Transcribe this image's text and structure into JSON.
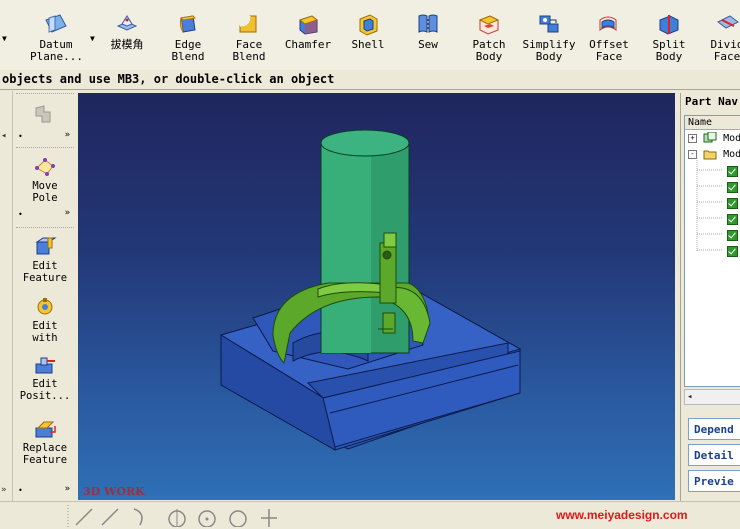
{
  "toolbar": {
    "items": [
      {
        "label": "Datum\nPlane...",
        "icon": "datum-plane-icon"
      },
      {
        "label": "拔模角",
        "icon": "draft-icon"
      },
      {
        "label": "Edge\nBlend",
        "icon": "edge-blend-icon"
      },
      {
        "label": "Face\nBlend",
        "icon": "face-blend-icon"
      },
      {
        "label": "Chamfer",
        "icon": "chamfer-icon"
      },
      {
        "label": "Shell",
        "icon": "shell-icon"
      },
      {
        "label": "Sew",
        "icon": "sew-icon"
      },
      {
        "label": "Patch\nBody",
        "icon": "patch-body-icon"
      },
      {
        "label": "Simplify\nBody",
        "icon": "simplify-body-icon"
      },
      {
        "label": "Offset\nFace",
        "icon": "offset-face-icon"
      },
      {
        "label": "Split\nBody",
        "icon": "split-body-icon"
      },
      {
        "label": "Divid\nFace",
        "icon": "divide-face-icon"
      }
    ]
  },
  "status": {
    "text": "objects and use MB3, or double-click an object"
  },
  "palette": {
    "items": [
      {
        "label": "Move\nPole",
        "icon": "move-pole-icon"
      },
      {
        "label": "Edit\nFeature",
        "icon": "edit-feature-icon"
      },
      {
        "label": "Edit\nwith",
        "icon": "edit-with-icon"
      },
      {
        "label": "Edit\nPosit...",
        "icon": "edit-position-icon"
      },
      {
        "label": "Replace\nFeature",
        "icon": "replace-feature-icon"
      }
    ]
  },
  "viewport": {
    "watermark": "3D WORK"
  },
  "part_navigator": {
    "title": "Part Nav",
    "column_name": "Name",
    "tree": [
      {
        "label": "Mod",
        "expander": "+"
      },
      {
        "label": "Mod",
        "expander": "-"
      }
    ],
    "checked_rows": 6
  },
  "right_buttons": [
    "Depend",
    "Detail",
    "Previe"
  ],
  "footer": {
    "site": "www.meiyadesign.com"
  },
  "colors": {
    "viewport_top": "#20265e",
    "viewport_bottom": "#2f70b6",
    "base_block": "#2b53b0",
    "cylinder": "#2f9e6c",
    "fork": "#5ca82a",
    "link_text": "#1b3f8f",
    "site_text": "#e01818"
  }
}
